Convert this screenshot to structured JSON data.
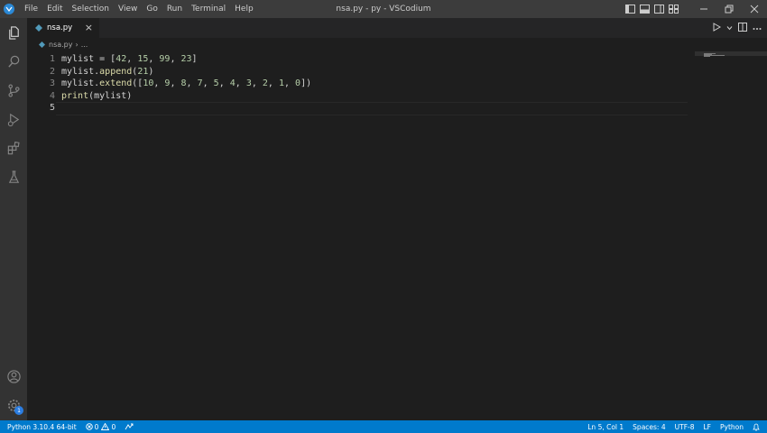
{
  "window": {
    "title": "nsa.py - py - VSCodium"
  },
  "menu": [
    "File",
    "Edit",
    "Selection",
    "View",
    "Go",
    "Run",
    "Terminal",
    "Help"
  ],
  "tab": {
    "label": "nsa.py",
    "close": "×"
  },
  "breadcrumb": {
    "file": "nsa.py",
    "sep": "›",
    "more": "..."
  },
  "editor": {
    "lines": [
      {
        "num": "1",
        "code": "mylist = [42, 15, 99, 23]"
      },
      {
        "num": "2",
        "code": "mylist.append(21)"
      },
      {
        "num": "3",
        "code": "mylist.extend([10, 9, 8, 7, 5, 4, 3, 2, 1, 0])"
      },
      {
        "num": "4",
        "code": "print(mylist)"
      },
      {
        "num": "5",
        "code": ""
      }
    ],
    "active_line": 5
  },
  "statusbar": {
    "interpreter": "Python 3.10.4 64-bit",
    "errors": "0",
    "warnings": "0",
    "position": "Ln 5, Col 1",
    "spaces": "Spaces: 4",
    "encoding": "UTF-8",
    "eol": "LF",
    "language": "Python"
  },
  "badges": {
    "settings": "1"
  },
  "colors": {
    "statusbar": "#007acc",
    "titlebar": "#3c3c3c",
    "activitybar": "#333333",
    "editor_bg": "#1e1e1e",
    "number": "#b5cea8",
    "function": "#dcdcaa"
  },
  "icons": {
    "activity": [
      "files-icon",
      "search-icon",
      "source-control-icon",
      "run-debug-icon",
      "extensions-icon",
      "testing-icon",
      "account-icon",
      "settings-gear-icon"
    ],
    "title": [
      "toggle-primary-sidebar-icon",
      "toggle-panel-icon",
      "toggle-secondary-sidebar-icon",
      "customize-layout-icon",
      "minimize-icon",
      "restore-icon",
      "close-icon"
    ],
    "editor": [
      "run-python-file-icon",
      "chevron-down-icon",
      "split-editor-icon",
      "more-actions-icon"
    ]
  }
}
